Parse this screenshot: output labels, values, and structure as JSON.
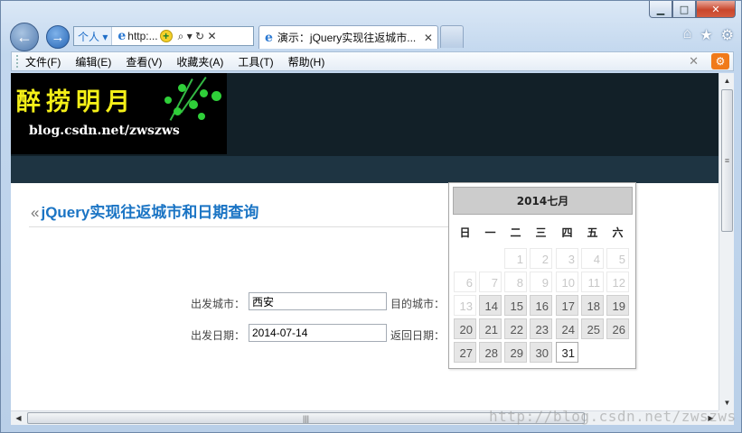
{
  "window": {
    "buttons": {
      "minimize": "▁",
      "maximize": "□",
      "close": "✕"
    }
  },
  "nav": {
    "back_icon": "←",
    "forward_icon": "→",
    "address": {
      "zone": "个人 ▾",
      "url": "http:...",
      "tools": "⌕ ▾ ↻ ✕"
    },
    "tab": {
      "title": "演示：jQuery实现往返城市...",
      "close": "✕"
    },
    "right_icons": [
      "⌂",
      "★",
      "⚙"
    ]
  },
  "menu": {
    "items": [
      "文件(F)",
      "编辑(E)",
      "查看(V)",
      "收藏夹(A)",
      "工具(T)",
      "帮助(H)"
    ],
    "close": "✕",
    "addon": "⚙"
  },
  "page": {
    "logo": {
      "title": "醉捞明月",
      "blog": "blog.csdn.net/zwszws"
    },
    "heading": {
      "laquo": "«",
      "text": "jQuery实现往返城市和日期查询"
    },
    "form": {
      "depart_city_label": "出发城市：",
      "depart_city_value": "西安",
      "dest_city_label": "目的城市：",
      "depart_date_label": "出发日期：",
      "depart_date_value": "2014-07-14",
      "return_date_label": "返回日期："
    }
  },
  "datepicker": {
    "header": "2014七月",
    "weekdays": [
      "日",
      "一",
      "二",
      "三",
      "四",
      "五",
      "六"
    ],
    "weeks": [
      [
        "",
        "",
        "1",
        "2",
        "3",
        "4",
        "5"
      ],
      [
        "6",
        "7",
        "8",
        "9",
        "10",
        "11",
        "12"
      ],
      [
        "13",
        "14",
        "15",
        "16",
        "17",
        "18",
        "19"
      ],
      [
        "20",
        "21",
        "22",
        "23",
        "24",
        "25",
        "26"
      ],
      [
        "27",
        "28",
        "29",
        "30",
        "31",
        "",
        ""
      ]
    ],
    "first_selectable_day": 14,
    "today": 31
  },
  "watermark": "http://blog.csdn.net/zwszws"
}
